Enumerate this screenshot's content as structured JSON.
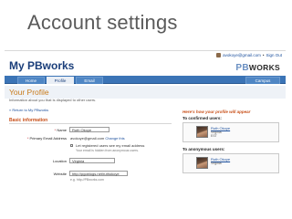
{
  "slide": {
    "title": "Account settings"
  },
  "util": {
    "email": "avokoye@gmail.com",
    "sep": "•",
    "signout": "Sign Out"
  },
  "brand": {
    "title": "My PBworks",
    "logo_pb": "PB",
    "logo_rest": "WORKS"
  },
  "nav": {
    "tabs": [
      "Home",
      "Profile",
      "Email"
    ],
    "right_tab": "Campus"
  },
  "page": {
    "heading": "Your Profile",
    "subtitle": "Information about you that is displayed to other users.",
    "back": "« Return to My PBworks"
  },
  "form": {
    "section": "Basic information",
    "name_label": "Name",
    "name_value": "Ruth Okoye",
    "email_label": "Primary Email Address",
    "email_value": "avokoye@gmail.com",
    "email_change": "Change this",
    "email_option": "Let registered users see my email address",
    "email_hint": "Your email is hidden from anonymous users.",
    "location_label": "Location",
    "location_value": "Virginia",
    "website_label": "Website",
    "website_value": "http://pgoblogs.net/ruthokoye",
    "website_hint": "e.g. http://PBworks.com",
    "required_marker": "*"
  },
  "preview": {
    "title": "Here's how your profile will appear",
    "confirmed_label": "To confirmed users:",
    "anonymous_label": "To anonymous users:",
    "confirmed_card": {
      "name": "Ruth Okoye",
      "location": "Virginia",
      "tz": "EST"
    },
    "anonymous_card": {
      "name": "Ruth Okoye",
      "location": "Virginia"
    }
  }
}
